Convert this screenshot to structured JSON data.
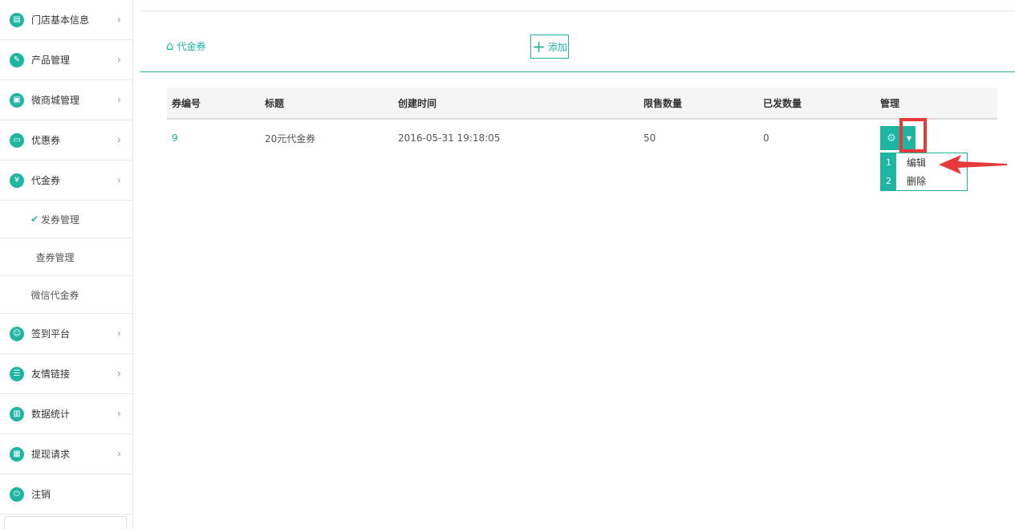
{
  "sidebar": {
    "items": [
      {
        "label": "门店基本信息",
        "icon": "document-icon",
        "glyph": "▤"
      },
      {
        "label": "产品管理",
        "icon": "tag-icon",
        "glyph": "✎"
      },
      {
        "label": "微商城管理",
        "icon": "shop-icon",
        "glyph": "▣"
      },
      {
        "label": "优惠券",
        "icon": "coupon-icon",
        "glyph": "▭"
      },
      {
        "label": "代金券",
        "icon": "voucher-icon",
        "glyph": "¥"
      }
    ],
    "sub_items": [
      {
        "label": "发券管理",
        "active": true
      },
      {
        "label": "查券管理"
      },
      {
        "label": "微信代金券"
      }
    ],
    "items_after": [
      {
        "label": "签到平台",
        "icon": "checkin-icon",
        "glyph": "☺"
      },
      {
        "label": "友情链接",
        "icon": "link-icon",
        "glyph": "☰"
      },
      {
        "label": "数据统计",
        "icon": "chart-icon",
        "glyph": "▥"
      },
      {
        "label": "提现请求",
        "icon": "wallet-icon",
        "glyph": "▦"
      },
      {
        "label": "注销",
        "icon": "power-icon",
        "glyph": "⏻"
      }
    ],
    "chevron": "›",
    "check_glyph": "✔"
  },
  "breadcrumb": {
    "label": "代金券",
    "icon": "home-icon",
    "glyph": "⌂"
  },
  "add_button": {
    "label": "添加",
    "icon": "plus-icon",
    "glyph": "+"
  },
  "table": {
    "columns": [
      "券编号",
      "标题",
      "创建时间",
      "限售数量",
      "已发数量",
      "管理"
    ],
    "rows": [
      {
        "id": "9",
        "title": "20元代金券",
        "created": "2016-05-31 19:18:05",
        "limit": "50",
        "issued": "0"
      }
    ]
  },
  "manage": {
    "gear_icon": "gear-icon",
    "gear_glyph": "⚙",
    "caret_glyph": "▼",
    "dropdown": [
      {
        "num": "1",
        "label": "编辑"
      },
      {
        "num": "2",
        "label": "删除"
      }
    ]
  },
  "colors": {
    "accent": "#1fb5a3",
    "highlight": "#e8393a"
  }
}
